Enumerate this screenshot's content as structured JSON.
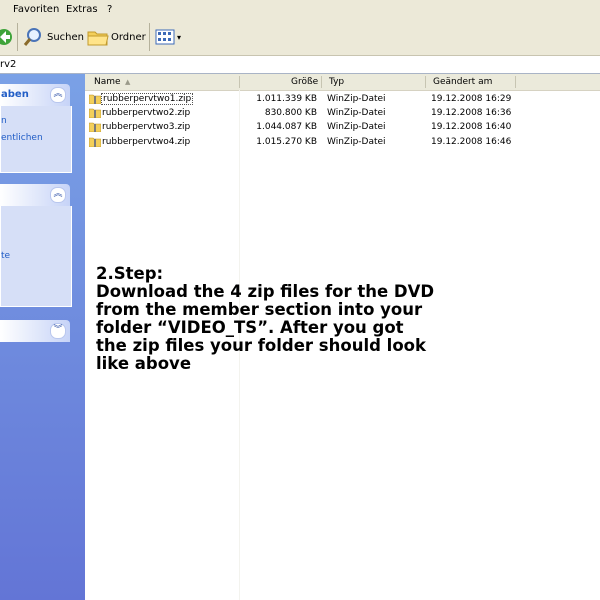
{
  "menu": {
    "favorites": "Favoriten",
    "extras": "Extras",
    "help": "?"
  },
  "toolbar": {
    "search_label": "Suchen",
    "folders_label": "Ordner"
  },
  "address": {
    "path": "rv2"
  },
  "taskpane": {
    "panel1_title": "aben",
    "panel1_links": [
      "n",
      "entlichen"
    ],
    "panel2_links": [
      "te"
    ]
  },
  "columns": {
    "name": "Name",
    "size": "Größe",
    "type": "Typ",
    "modified": "Geändert am"
  },
  "files": [
    {
      "name": "rubberpervtwo1.zip",
      "size": "1.011.339 KB",
      "type": "WinZip-Datei",
      "modified": "19.12.2008 16:29"
    },
    {
      "name": "rubberpervtwo2.zip",
      "size": "830.800 KB",
      "type": "WinZip-Datei",
      "modified": "19.12.2008 16:36"
    },
    {
      "name": "rubberpervtwo3.zip",
      "size": "1.044.087 KB",
      "type": "WinZip-Datei",
      "modified": "19.12.2008 16:40"
    },
    {
      "name": "rubberpervtwo4.zip",
      "size": "1.015.270 KB",
      "type": "WinZip-Datei",
      "modified": "19.12.2008 16:46"
    }
  ],
  "caption": {
    "line1": "2.Step:",
    "line2": "Download the 4 zip files for the DVD",
    "line3": "from the member section into your",
    "line4": "folder “VIDEO_TS”. After you got",
    "line5": "the zip files your folder should look",
    "line6": "like above"
  }
}
